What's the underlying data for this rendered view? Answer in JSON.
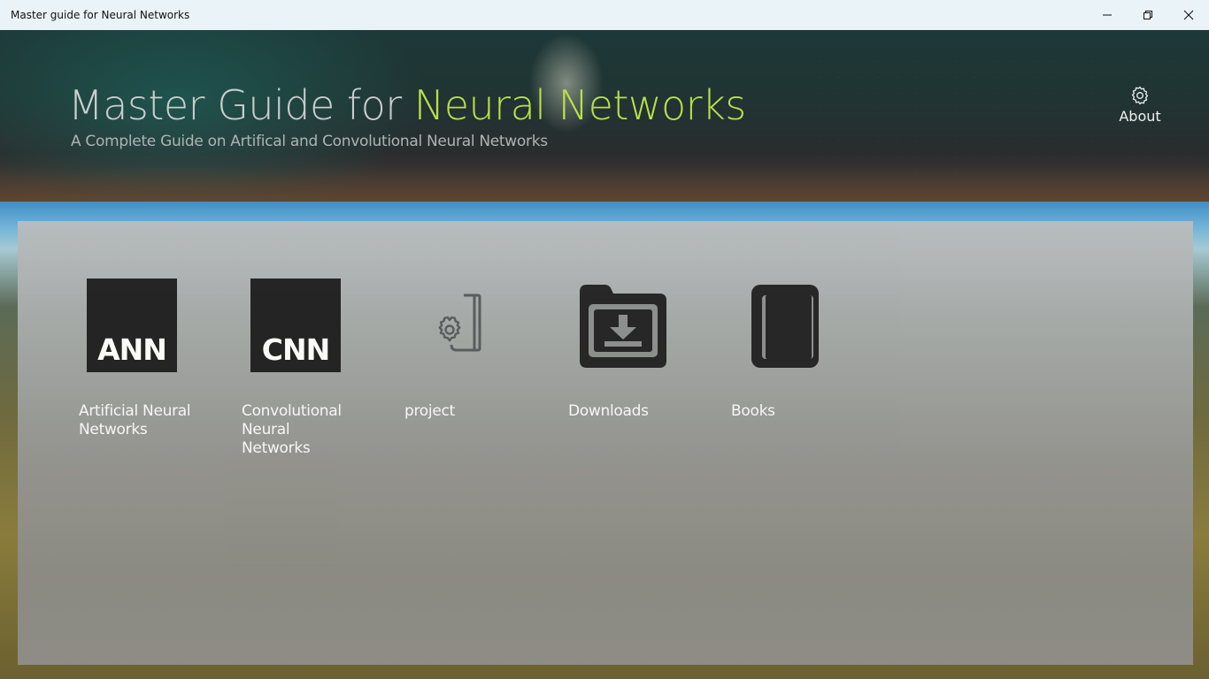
{
  "window": {
    "title": "Master guide for Neural Networks",
    "controls": [
      "minimize-icon",
      "restore-icon",
      "close-icon"
    ]
  },
  "header": {
    "title_plain": "Master Guide for",
    "title_accent": "Neural Networks",
    "subtitle": "A Complete Guide on Artifical and Convolutional Neural Networks",
    "about_label": "About",
    "about_icon": "gear-icon",
    "accent_color": "#b8e04a"
  },
  "tiles": [
    {
      "label": "Artificial Neural Networks",
      "icon_text": "ANN",
      "icon": "ann-square-icon"
    },
    {
      "label": "Convolutional Neural Networks",
      "icon_text": "CNN",
      "icon": "cnn-square-icon"
    },
    {
      "label": "project",
      "icon": "gear-document-icon"
    },
    {
      "label": "Downloads",
      "icon": "download-folder-icon"
    },
    {
      "label": "Books",
      "icon": "book-icon"
    }
  ]
}
